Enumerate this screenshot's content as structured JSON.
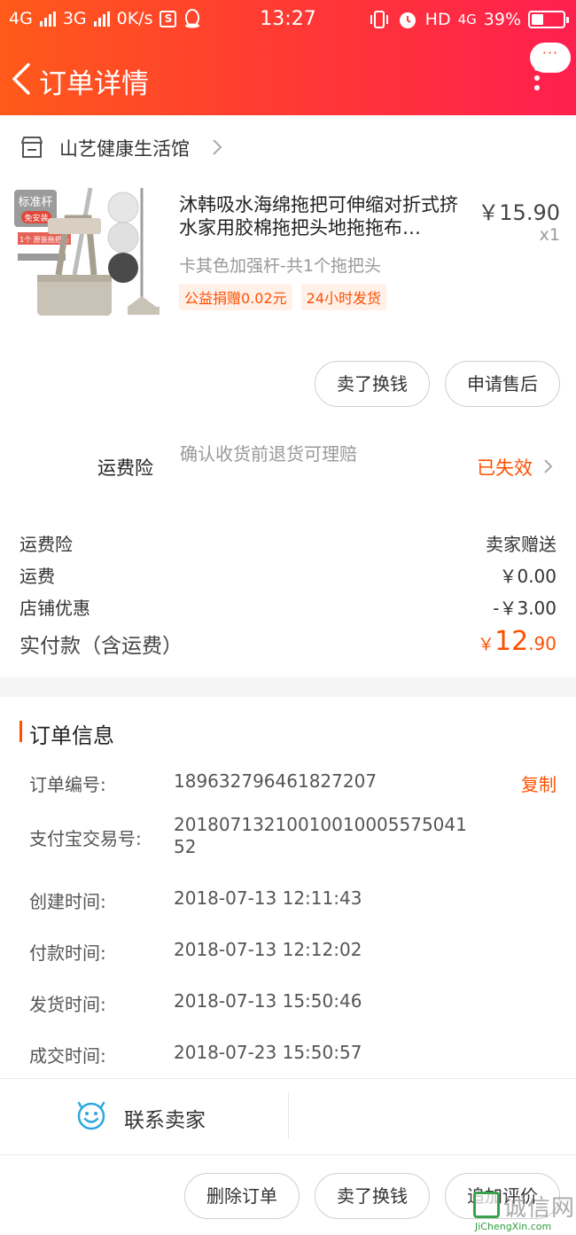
{
  "status_bar": {
    "net1": "4G",
    "net2": "3G",
    "speed": "0K/s",
    "s_icon": "S",
    "time": "13:27",
    "hd": "HD",
    "net3": "4G",
    "battery": "39%",
    "battery_level": 0.39
  },
  "header": {
    "title": "订单详情",
    "more_dots": "···"
  },
  "shop": {
    "name": "山艺健康生活馆"
  },
  "product": {
    "title": "沐韩吸水海绵拖把可伸缩对折式挤水家用胶棉拖把头地拖拖布…",
    "price": "￥15.90",
    "qty": "x1",
    "sku": "卡其色加强杆-共1个拖把头",
    "tags": [
      "公益捐赠0.02元",
      "24小时发货"
    ],
    "image_labels": [
      "标准杆",
      "免安装",
      "1个 原装拖把头"
    ]
  },
  "item_actions": {
    "sell": "卖了换钱",
    "after_sale": "申请售后"
  },
  "insurance": {
    "label": "运费险",
    "desc": "确认收货前退货可理赔",
    "status": "已失效"
  },
  "fees": [
    {
      "label": "运费险",
      "value": "卖家赠送"
    },
    {
      "label": "运费",
      "value": "￥0.00"
    },
    {
      "label": "店铺优惠",
      "value": "-￥3.00"
    }
  ],
  "total": {
    "label": "实付款（含运费）",
    "currency": "￥",
    "int": "12",
    "dec": ".90"
  },
  "order_info": {
    "title": "订单信息",
    "copy": "复制",
    "rows": [
      {
        "label": "订单编号:",
        "value": "189632796461827207"
      },
      {
        "label": "支付宝交易号:",
        "value": "20180713210010010005575041 52"
      },
      {
        "label": "创建时间:",
        "value": "2018-07-13 12:11:43"
      },
      {
        "label": "付款时间:",
        "value": "2018-07-13 12:12:02"
      },
      {
        "label": "发货时间:",
        "value": "2018-07-13 15:50:46"
      },
      {
        "label": "成交时间:",
        "value": "2018-07-23 15:50:57"
      }
    ]
  },
  "contact": {
    "label": "联系卖家"
  },
  "bottom_actions": {
    "delete": "删除订单",
    "sell": "卖了换钱",
    "review": "追加评价"
  },
  "watermark": {
    "cn": "诚信网",
    "en": "JiChengXin.com"
  },
  "colors": {
    "accent": "#ff5000",
    "header_start": "#ff5a1a",
    "header_end": "#ff1f4f"
  },
  "icons": [
    "back-icon",
    "store-icon",
    "chevron-right-icon",
    "smiley-icon",
    "more-icon",
    "alarm-icon",
    "vibrate-icon"
  ]
}
